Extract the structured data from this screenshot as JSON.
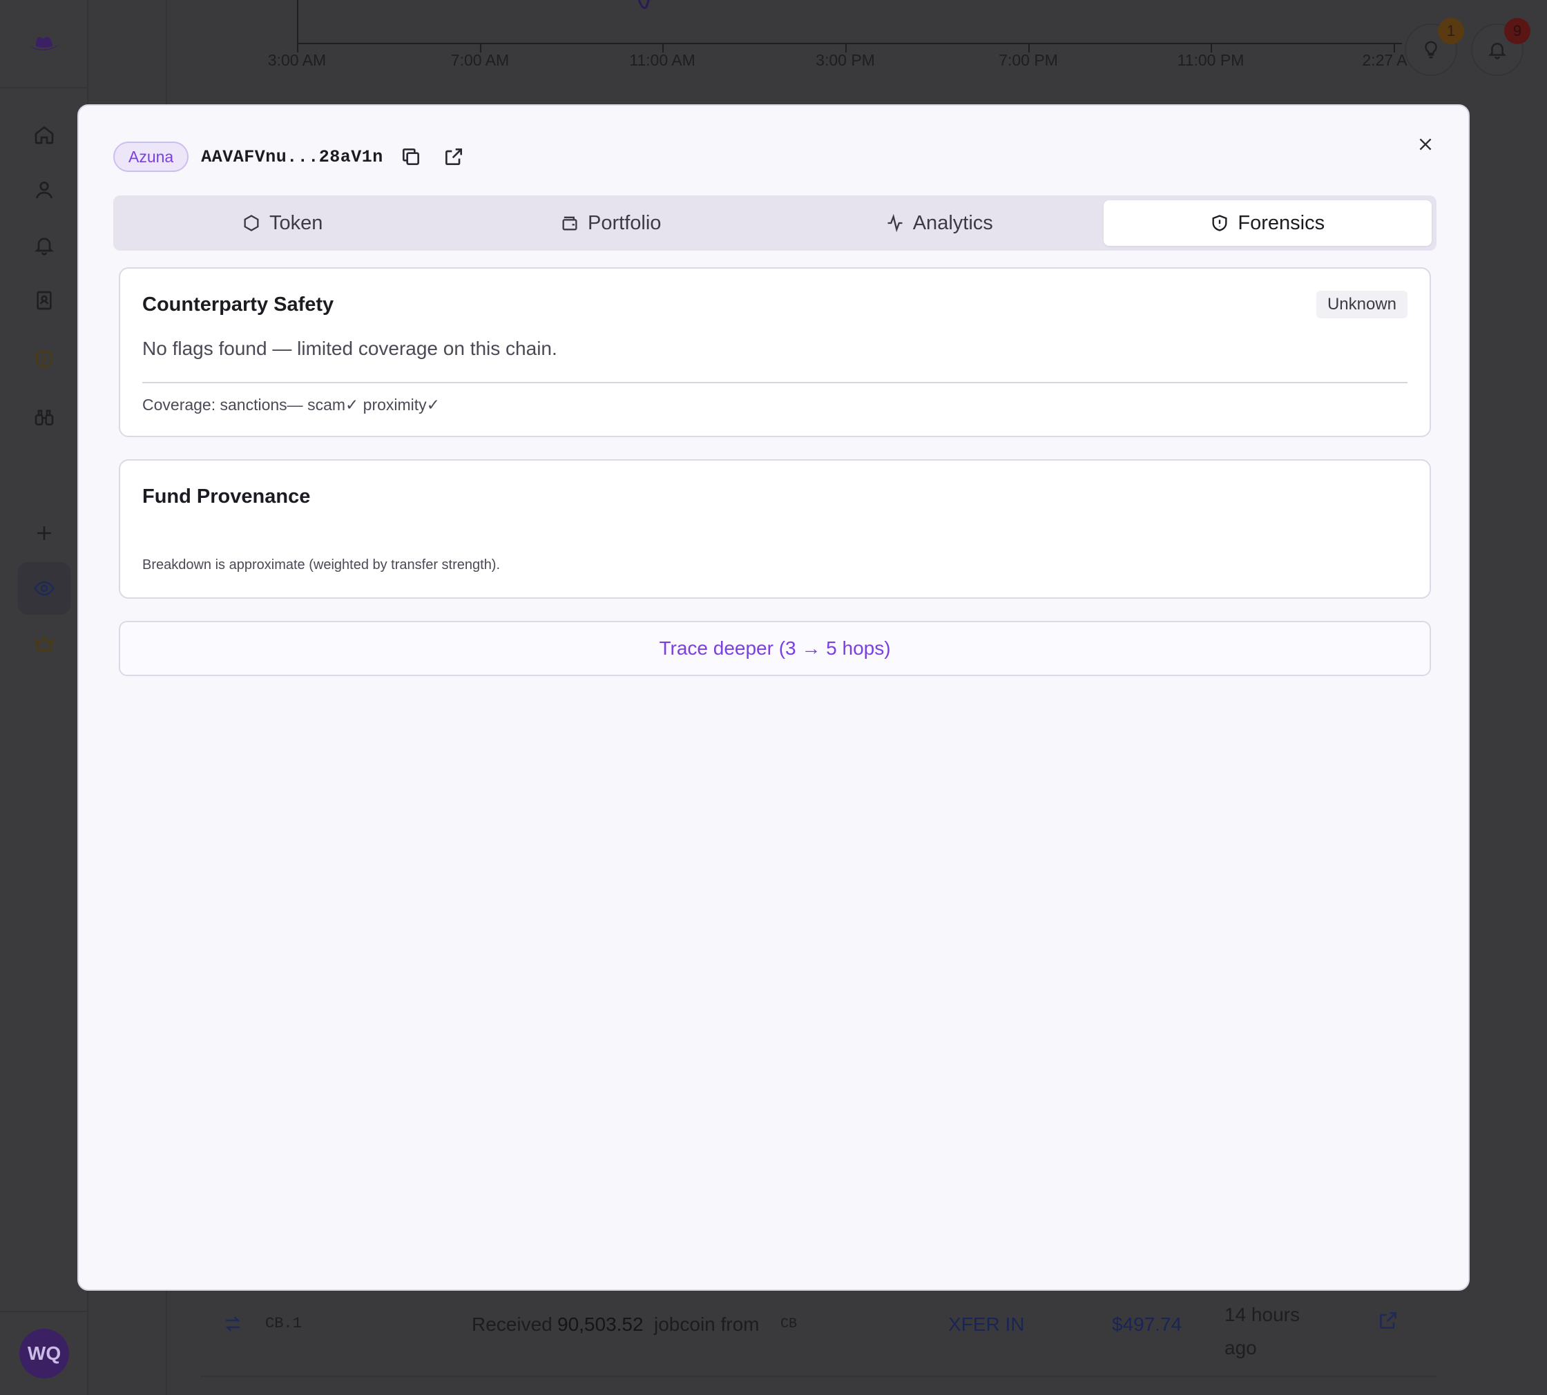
{
  "chart": {
    "ticks": [
      "3:00 AM",
      "7:00 AM",
      "11:00 AM",
      "3:00 PM",
      "7:00 PM",
      "11:00 PM",
      "2:27 A"
    ]
  },
  "header": {
    "tips_badge": "1",
    "notifications_badge": "9"
  },
  "user": {
    "initials": "WQ"
  },
  "background_row": {
    "token": "CB.1",
    "description_prefix": "Received",
    "amount": "90,503.52",
    "description_mid": "jobcoin from",
    "counterparty": "CB",
    "type": "XFER IN",
    "value": "$497.74",
    "time": "14 hours ago"
  },
  "modal": {
    "chain": "Azuna",
    "address": "AAVAFVnu...28aV1n",
    "tabs": [
      {
        "label": "Token",
        "icon": "hexagon-icon"
      },
      {
        "label": "Portfolio",
        "icon": "wallet-icon"
      },
      {
        "label": "Analytics",
        "icon": "activity-icon"
      },
      {
        "label": "Forensics",
        "icon": "shield-icon",
        "active": true
      }
    ],
    "safety": {
      "title": "Counterparty Safety",
      "status": "Unknown",
      "description": "No flags found — limited coverage on this chain.",
      "coverage": "Coverage: sanctions— scam✓ proximity✓"
    },
    "provenance": {
      "title": "Fund Provenance",
      "footnote": "Breakdown is approximate (weighted by transfer strength)."
    },
    "trace_button": "Trace deeper (3 → 5 hops)"
  },
  "colors": {
    "accent": "#7b3fe0",
    "overlay": "#3a3a3c",
    "modal_bg": "#f8f7fc"
  }
}
